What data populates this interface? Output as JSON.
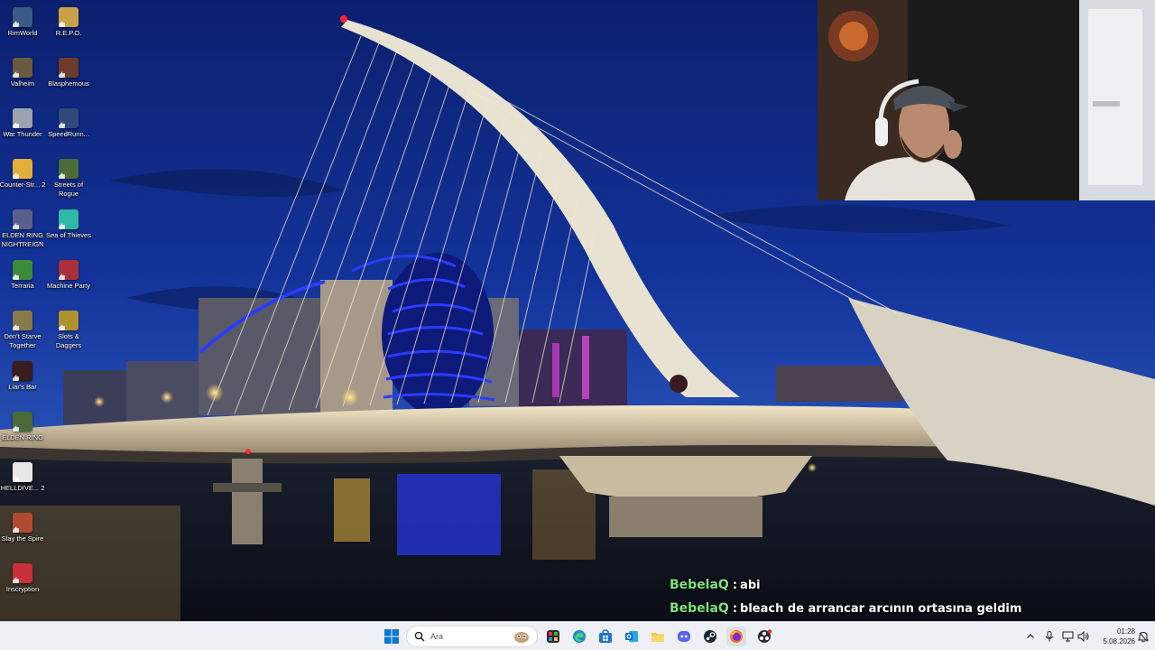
{
  "desktop_icons": [
    {
      "id": "rimworld",
      "label": "RimWorld",
      "color": "#3b5b86"
    },
    {
      "id": "repo",
      "label": "R.E.P.O.",
      "color": "#c8a14a"
    },
    {
      "id": "valheim",
      "label": "Valheim",
      "color": "#6b5a3e"
    },
    {
      "id": "blasphemous",
      "label": "Blasphemous",
      "color": "#6e3b2a"
    },
    {
      "id": "war-thunder",
      "label": "War Thunder",
      "color": "#9aa3ae"
    },
    {
      "id": "speedrunners",
      "label": "SpeedRunn...",
      "color": "#2f4a7a"
    },
    {
      "id": "counter-strike-2",
      "label": "Counter-Str... 2",
      "color": "#e2b03a"
    },
    {
      "id": "streets-of-rogue",
      "label": "Streets of Rogue",
      "color": "#4c6b3b"
    },
    {
      "id": "elden-ring-nightreign",
      "label": "ELDEN RING NIGHTREIGN",
      "color": "#5a5f8c"
    },
    {
      "id": "sea-of-thieves",
      "label": "Sea of Thieves",
      "color": "#2fb8a6"
    },
    {
      "id": "terraria",
      "label": "Terraria",
      "color": "#3d8a3a"
    },
    {
      "id": "machine-party",
      "label": "Machine Party",
      "color": "#a8303a"
    },
    {
      "id": "dont-starve-together",
      "label": "Don't Starve Together",
      "color": "#8a7a4a"
    },
    {
      "id": "slots-and-daggers",
      "label": "Slots & Daggers",
      "color": "#b09030"
    },
    {
      "id": "liars-bar",
      "label": "Liar's Bar",
      "color": "#3a1c1c"
    },
    {
      "id": "elden-ring",
      "label": "ELDEN RING",
      "color": "#4a6a3a"
    },
    {
      "id": "helldivers-2",
      "label": "HELLDIVE... 2",
      "color": "#e8e8e8"
    },
    {
      "id": "slay-the-spire",
      "label": "Slay the Spire",
      "color": "#b24a30"
    },
    {
      "id": "inscryption",
      "label": "Inscryption",
      "color": "#c8303a"
    }
  ],
  "chat": [
    {
      "user": "BebelaQ",
      "separator": ":",
      "message": "abi"
    },
    {
      "user": "BebelaQ",
      "separator": ":",
      "message": "bleach de arrancar arcının ortasına geldim"
    }
  ],
  "colors": {
    "chat_username": "#7ee37a",
    "sky_top": "#0b1f6e",
    "sky_bottom": "#2a55b8",
    "neon_blue": "#2a3cff",
    "taskbar_bg": "#eef0f5"
  },
  "taskbar": {
    "search_placeholder": "Ara",
    "apps": [
      {
        "id": "start",
        "icon": "windows-start-icon"
      },
      {
        "id": "task-view",
        "icon": "task-view-icon"
      },
      {
        "id": "edge",
        "icon": "edge-icon"
      },
      {
        "id": "store",
        "icon": "store-icon"
      },
      {
        "id": "outlook",
        "icon": "outlook-icon"
      },
      {
        "id": "file-explorer",
        "icon": "folder-icon"
      },
      {
        "id": "discord",
        "icon": "discord-icon"
      },
      {
        "id": "steam",
        "icon": "steam-icon"
      },
      {
        "id": "firefox",
        "icon": "firefox-icon"
      },
      {
        "id": "obs",
        "icon": "obs-icon"
      }
    ],
    "time": "01:28",
    "date": "5.08.2026"
  }
}
